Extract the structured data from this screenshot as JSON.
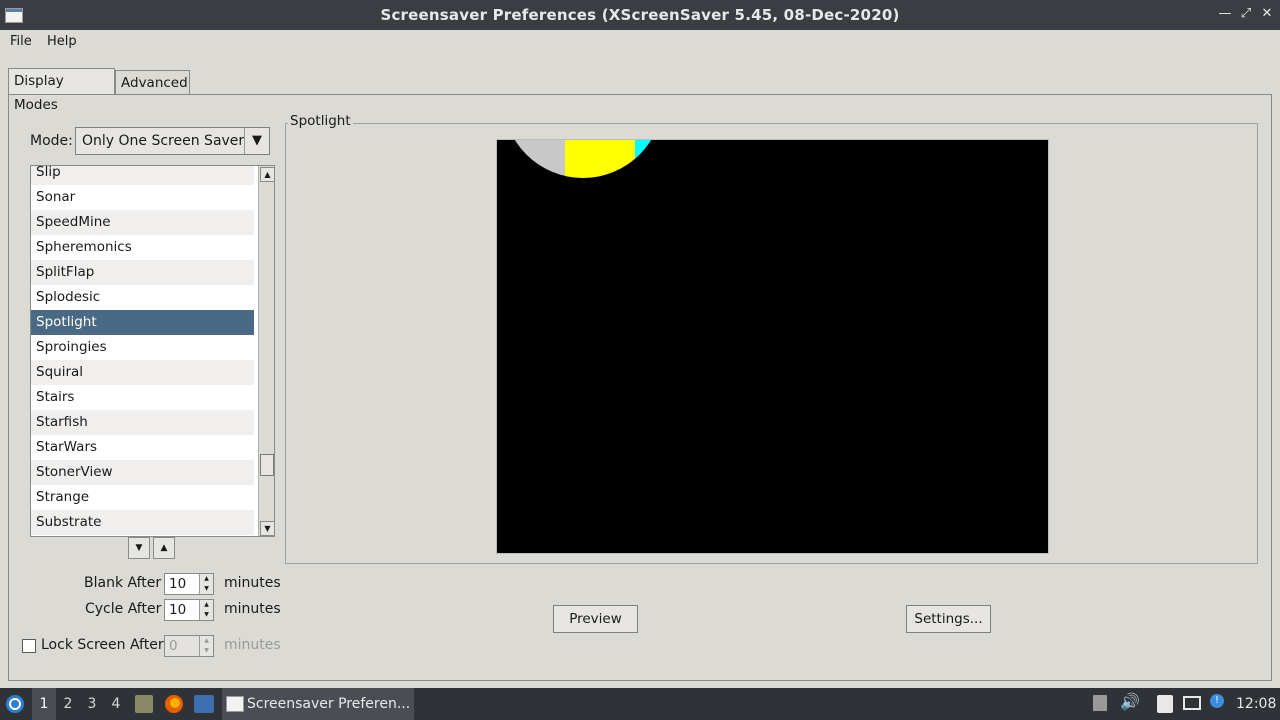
{
  "window": {
    "title": "Screensaver Preferences  (XScreenSaver 5.45, 08-Dec-2020)"
  },
  "menu": {
    "file": "File",
    "help": "Help"
  },
  "tabs": {
    "display_modes": "Display Modes",
    "advanced": "Advanced"
  },
  "mode": {
    "label": "Mode:",
    "value": "Only One Screen Saver"
  },
  "list": {
    "items": [
      "Slip",
      "Sonar",
      "SpeedMine",
      "Spheremonics",
      "SplitFlap",
      "Splodesic",
      "Spotlight",
      "Sproingies",
      "Squiral",
      "Stairs",
      "Starfish",
      "StarWars",
      "StonerView",
      "Strange",
      "Substrate"
    ],
    "selected": "Spotlight"
  },
  "settings": {
    "blank_label": "Blank After",
    "blank_value": "10",
    "cycle_label": "Cycle After",
    "cycle_value": "10",
    "lock_label": "Lock Screen After",
    "lock_value": "0",
    "units": "minutes"
  },
  "preview": {
    "legend": "Spotlight",
    "preview_button": "Preview",
    "settings_button": "Settings..."
  },
  "taskbar": {
    "workspaces": [
      "1",
      "2",
      "3",
      "4"
    ],
    "task": "Screensaver Preferen...",
    "clock": "12:08"
  },
  "colors": {
    "selection": "#4a6984",
    "titlebar": "#3a3d41",
    "taskbar": "#2f3338"
  }
}
